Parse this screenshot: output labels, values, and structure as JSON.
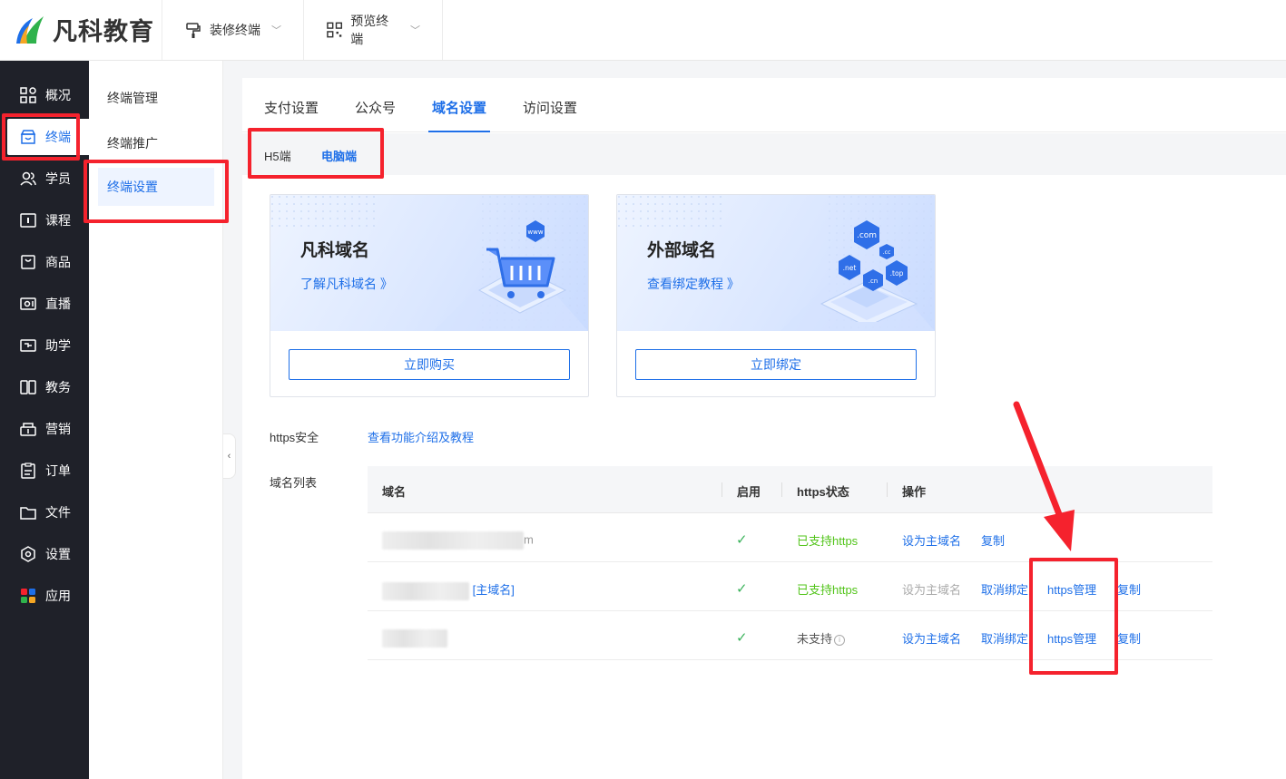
{
  "app": {
    "logo_text": "凡科教育"
  },
  "topbar": {
    "menus": [
      {
        "label": "装修终端"
      },
      {
        "label": "预览终端"
      }
    ]
  },
  "sidebar": {
    "items": [
      {
        "label": "概况",
        "icon": "grid-icon"
      },
      {
        "label": "终端",
        "icon": "store-icon",
        "active": true
      },
      {
        "label": "学员",
        "icon": "users-icon"
      },
      {
        "label": "课程",
        "icon": "course-icon"
      },
      {
        "label": "商品",
        "icon": "goods-icon"
      },
      {
        "label": "直播",
        "icon": "live-icon"
      },
      {
        "label": "助学",
        "icon": "assist-icon"
      },
      {
        "label": "教务",
        "icon": "academic-icon"
      },
      {
        "label": "营销",
        "icon": "marketing-icon"
      },
      {
        "label": "订单",
        "icon": "order-icon"
      },
      {
        "label": "文件",
        "icon": "folder-icon"
      },
      {
        "label": "设置",
        "icon": "settings-icon"
      },
      {
        "label": "应用",
        "icon": "apps-icon"
      }
    ]
  },
  "submenu": {
    "items": [
      {
        "label": "终端管理"
      },
      {
        "label": "终端推广"
      },
      {
        "label": "终端设置",
        "active": true
      }
    ]
  },
  "tabs": [
    {
      "label": "支付设置"
    },
    {
      "label": "公众号"
    },
    {
      "label": "域名设置",
      "active": true
    },
    {
      "label": "访问设置"
    }
  ],
  "subtabs": [
    {
      "label": "H5端"
    },
    {
      "label": "电脑端",
      "active": true
    }
  ],
  "cards": [
    {
      "title": "凡科域名",
      "link": "了解凡科域名 》",
      "button": "立即购买",
      "badges": [
        "www"
      ]
    },
    {
      "title": "外部域名",
      "link": "查看绑定教程 》",
      "button": "立即绑定",
      "badges": [
        ".com",
        ".cc",
        ".net",
        ".top",
        ".cn"
      ]
    }
  ],
  "https_section": {
    "label": "https安全",
    "link": "查看功能介绍及教程"
  },
  "domain_list": {
    "label": "域名列表",
    "columns": [
      "域名",
      "启用",
      "https状态",
      "操作"
    ],
    "rows": [
      {
        "domain_suffix": "m",
        "enabled": "✓",
        "status": "已支持https",
        "actions": [
          "设为主域名",
          "复制"
        ]
      },
      {
        "domain_suffix": "[主域名]",
        "enabled": "✓",
        "status": "已支持https",
        "actions": [
          "设为主域名",
          "取消绑定",
          "https管理",
          "复制"
        ]
      },
      {
        "domain_suffix": "",
        "enabled": "✓",
        "status": "未支持",
        "actions": [
          "设为主域名",
          "取消绑定",
          "https管理",
          "复制"
        ]
      }
    ]
  },
  "colors": {
    "accent": "#1e6fe8",
    "sidebar_bg": "#1f2129",
    "success": "#52c41a",
    "highlight": "#f5222d"
  }
}
